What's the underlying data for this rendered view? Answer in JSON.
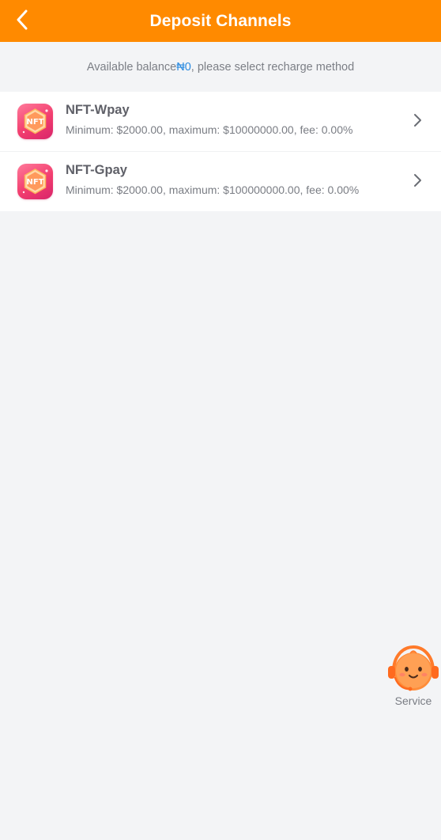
{
  "header": {
    "title": "Deposit Channels",
    "background_color": "#ff8a00"
  },
  "balance": {
    "prefix": "Available balance ",
    "amount": "₦0",
    "suffix": ", please select recharge method",
    "amount_color": "#2b8be0"
  },
  "channels": [
    {
      "name": "NFT-Wpay",
      "limits": "Minimum: $2000.00, maximum: $10000000.00, fee: 0.00%",
      "icon": "nft-icon"
    },
    {
      "name": "NFT-Gpay",
      "limits": "Minimum: $2000.00, maximum: $100000000.00, fee: 0.00%",
      "icon": "nft-icon"
    }
  ],
  "service": {
    "label": "Service",
    "icon": "customer-service-mascot-icon"
  },
  "icon_text": "NFT"
}
